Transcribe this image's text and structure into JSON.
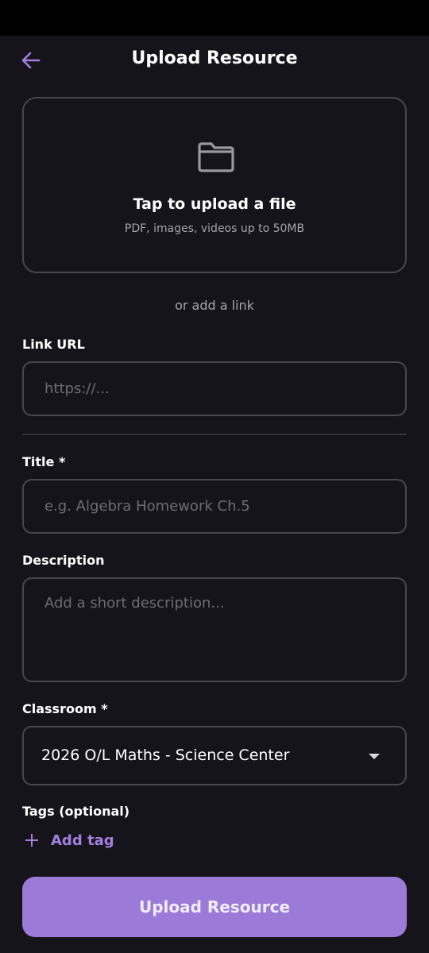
{
  "header": {
    "title": "Upload Resource",
    "back_icon": "arrow-left-icon"
  },
  "upload": {
    "icon": "folder-icon",
    "title": "Tap to upload a file",
    "subtitle": "PDF, images, videos up to 50MB"
  },
  "or_link": "or add a link",
  "link_url": {
    "label": "Link URL",
    "value": "",
    "placeholder": "https://..."
  },
  "title_field": {
    "label": "Title *",
    "value": "",
    "placeholder": "e.g. Algebra Homework Ch.5"
  },
  "description": {
    "label": "Description",
    "value": "",
    "placeholder": "Add a short description..."
  },
  "classroom": {
    "label": "Classroom *",
    "selected": "2026 O/L Maths - Science Center"
  },
  "tags": {
    "label": "Tags (optional)",
    "add_label": "Add tag"
  },
  "submit_label": "Upload Resource",
  "colors": {
    "background": "#15141b",
    "accent": "#9b7ad8",
    "accent_text": "#a57fe0",
    "border": "#48464f"
  }
}
